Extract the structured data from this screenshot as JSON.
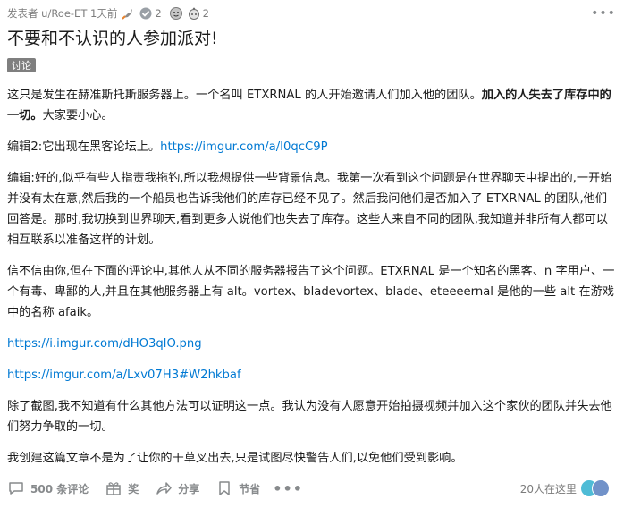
{
  "meta": {
    "posted_by": "发表者 u/Roe-ET 1天前",
    "award_1_count": "2",
    "award_2_count": "2"
  },
  "post": {
    "title": "不要和不认识的人参加派对!",
    "flair": "讨论",
    "p1_text": "这只是发生在赫准斯托斯服务器上。一个名叫 ETXRNAL 的人开始邀请人们加入他的团队。",
    "p1_bold": "加入的人失去了库存中的一切。",
    "p1_tail": "大家要小心。",
    "p2_text": "编辑2:它出现在黑客论坛上。",
    "p2_link": "https://imgur.com/a/I0qcC9P",
    "p3": "编辑:好的,似乎有些人指责我拖钓,所以我想提供一些背景信息。我第一次看到这个问题是在世界聊天中提出的,一开始并没有太在意,然后我的一个船员也告诉我他们的库存已经不见了。然后我问他们是否加入了 ETXRNAL 的团队,他们回答是。那时,我切换到世界聊天,看到更多人说他们也失去了库存。这些人来自不同的团队,我知道并非所有人都可以相互联系以准备这样的计划。",
    "p4": "信不信由你,但在下面的评论中,其他人从不同的服务器报告了这个问题。ETXRNAL 是一个知名的黑客、n 字用户、一个有毒、卑鄙的人,并且在其他服务器上有 alt。vortex、bladevortex、blade、eteeeernal 是他的一些 alt 在游戏中的名称 afaik。",
    "link1": "https://i.imgur.com/dHO3qlO.png",
    "link2": "https://imgur.com/a/Lxv07H3#W2hkbaf",
    "p5": "除了截图,我不知道有什么其他方法可以证明这一点。我认为没有人愿意开始拍摄视频并加入这个家伙的团队并失去他们努力争取的一切。",
    "p6": "我创建这篇文章不是为了让你的干草叉出去,只是试图尽快警告人们,以免他们受到影响。"
  },
  "actions": {
    "comments": "500 条评论",
    "award": "奖",
    "share": "分享",
    "save": "节省",
    "viewers": "20人在这里"
  },
  "colors": {
    "link": "#0079d3",
    "flair_bg": "#7f7f7f",
    "muted": "#878a8c"
  }
}
